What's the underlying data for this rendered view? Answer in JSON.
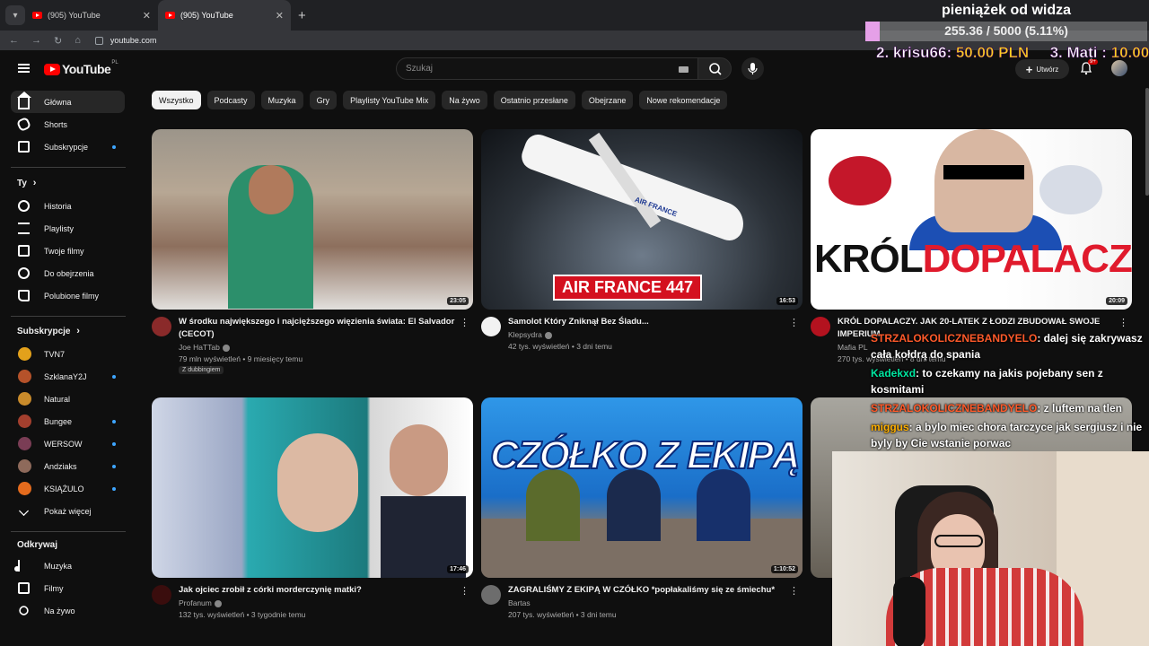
{
  "browser": {
    "tabs": [
      {
        "title": "(905) YouTube",
        "active": false
      },
      {
        "title": "(905) YouTube",
        "active": true
      }
    ],
    "url": "youtube.com"
  },
  "masthead": {
    "logo_text": "YouTube",
    "logo_region": "PL",
    "search_placeholder": "Szukaj",
    "create_label": "Utwórz",
    "notif_badge": "9+"
  },
  "stream_overlay": {
    "title": "pieniążek od widza",
    "goal_text": "255.36 / 5000 (5.11%)",
    "goal_fraction": 0.0511,
    "top1_name": "2. krisu66:",
    "top1_amount": "50.00 PLN",
    "top2_name": "3. Mati :",
    "top2_amount": "10.00"
  },
  "sidebar": {
    "main": [
      {
        "label": "Główna",
        "icon": "home-icon",
        "active": true
      },
      {
        "label": "Shorts",
        "icon": "shorts-icon"
      },
      {
        "label": "Subskrypcje",
        "icon": "subscriptions-icon",
        "dot": true
      }
    ],
    "you_header": "Ty",
    "you": [
      {
        "label": "Historia",
        "icon": "history-icon"
      },
      {
        "label": "Playlisty",
        "icon": "playlist-icon"
      },
      {
        "label": "Twoje filmy",
        "icon": "your-videos-icon"
      },
      {
        "label": "Do obejrzenia",
        "icon": "watch-later-icon"
      },
      {
        "label": "Polubione filmy",
        "icon": "liked-icon"
      }
    ],
    "subs_header": "Subskrypcje",
    "subs": [
      {
        "label": "TVN7",
        "color": "#e3a11b",
        "dot": false
      },
      {
        "label": "SzklanaY2J",
        "color": "#b5522a",
        "dot": true
      },
      {
        "label": "Natural",
        "color": "#c98b2b",
        "dot": false
      },
      {
        "label": "Bungee",
        "color": "#a33f2e",
        "dot": true
      },
      {
        "label": "WERSOW",
        "color": "#7a3d55",
        "dot": true
      },
      {
        "label": "Andziaks",
        "color": "#8e6a5b",
        "dot": true
      },
      {
        "label": "KSIĄŻULO",
        "color": "#e46b1d",
        "dot": true
      }
    ],
    "show_more": "Pokaż więcej",
    "explore_header": "Odkrywaj",
    "explore": [
      {
        "label": "Muzyka",
        "icon": "music-icon"
      },
      {
        "label": "Filmy",
        "icon": "films-icon"
      },
      {
        "label": "Na żywo",
        "icon": "live-icon"
      }
    ]
  },
  "chips": [
    "Wszystko",
    "Podcasty",
    "Muzyka",
    "Gry",
    "Playlisty YouTube Mix",
    "Na żywo",
    "Ostatnio przesłane",
    "Obejrzane",
    "Nowe rekomendacje"
  ],
  "videos": [
    {
      "title": "W środku największego i najcięższego więzienia świata: El Salvador (CECOT)",
      "channel": "Joe HaTTab",
      "meta": "79 mln wyświetleń • 9 miesięcy temu",
      "duration": "23:05",
      "tag": "Z dubbingiem"
    },
    {
      "title": "Samolot Który Zniknął Bez Śladu...",
      "channel": "Klepsydra",
      "meta": "42 tys. wyświetleń • 3 dni temu",
      "duration": "16:53",
      "thumb_text": "AIR FRANCE 447",
      "plane_text": "AIR FRANCE"
    },
    {
      "title": "KRÓL DOPALACZY. JAK 20-LATEK Z ŁODZI ZBUDOWAŁ SWOJE IMPERIUM",
      "channel": "Mafia PL",
      "meta": "270 tys. wyświetleń • 8 dni temu",
      "duration": "20:09",
      "thumb_text_a": "KRÓL",
      "thumb_text_b": "DOPALACZY"
    },
    {
      "title": "Jak ojciec zrobił z córki morderczynię matki?",
      "channel": "Profanum",
      "meta": "132 tys. wyświetleń • 3 tygodnie temu",
      "duration": "17:46"
    },
    {
      "title": "ZAGRALIŚMY Z EKIPĄ W CZÓŁKO *popłakaliśmy się ze śmiechu*",
      "channel": "Bartas",
      "meta": "207 tys. wyświetleń • 3 dni temu",
      "duration": "1:10:52",
      "thumb_text": "CZÓŁKO Z EKIPĄ"
    }
  ],
  "chat": [
    {
      "user": "STRZALOKOLICZNEBANDYELO",
      "text": ": dalej się zakrywasz cała kołdrą do spania"
    },
    {
      "user": "Kadekxd",
      "text": ": to czekamy na jakis pojebany sen z kosmitami"
    },
    {
      "user": "STRZALOKOLICZNEBANDYELO",
      "text": ": z luftem na tlen"
    },
    {
      "user": "miggus",
      "text": ": a bylo miec chora tarczyce jak sergiusz i nie byly by Cie wstanie porwac"
    }
  ]
}
